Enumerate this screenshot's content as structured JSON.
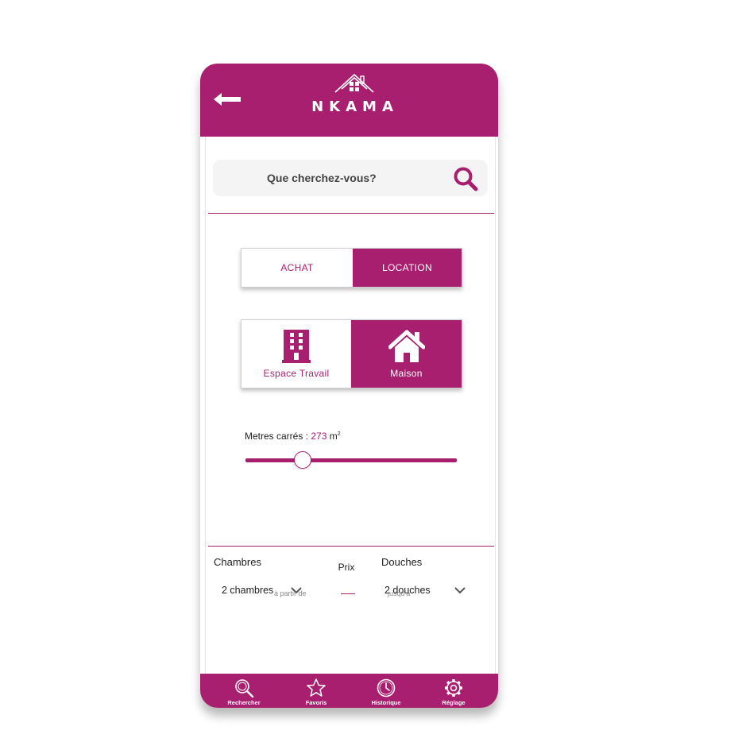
{
  "app": {
    "logo_text": "NKAMA"
  },
  "search": {
    "placeholder": "Que cherchez-vous?"
  },
  "transaction": {
    "options": [
      {
        "label": "ACHAT",
        "selected": false
      },
      {
        "label": "LOCATION",
        "selected": true
      }
    ]
  },
  "property_type": {
    "options": [
      {
        "label": "Espace Travail",
        "icon": "office-building-icon",
        "selected": false
      },
      {
        "label": "Maison",
        "icon": "house-icon",
        "selected": true
      }
    ]
  },
  "surface": {
    "label": "Metres carrés : ",
    "value": "273",
    "unit": "m",
    "exponent": "2",
    "slider_fraction": 0.27
  },
  "bedrooms": {
    "label": "Chambres",
    "value": "2 chambres"
  },
  "showers": {
    "label": "Douches",
    "value": "2 douches"
  },
  "price": {
    "label": "Prix",
    "from_placeholder": "à partir de",
    "to_placeholder": "jusqu'à"
  },
  "nav": {
    "items": [
      {
        "label": "Rechercher",
        "icon": "search-icon"
      },
      {
        "label": "Favoris",
        "icon": "star-icon"
      },
      {
        "label": "Historique",
        "icon": "clock-icon"
      },
      {
        "label": "Réglage",
        "icon": "gear-icon"
      }
    ]
  },
  "colors": {
    "brand": "#a81f6f",
    "search_bg": "#f4f4f4"
  }
}
